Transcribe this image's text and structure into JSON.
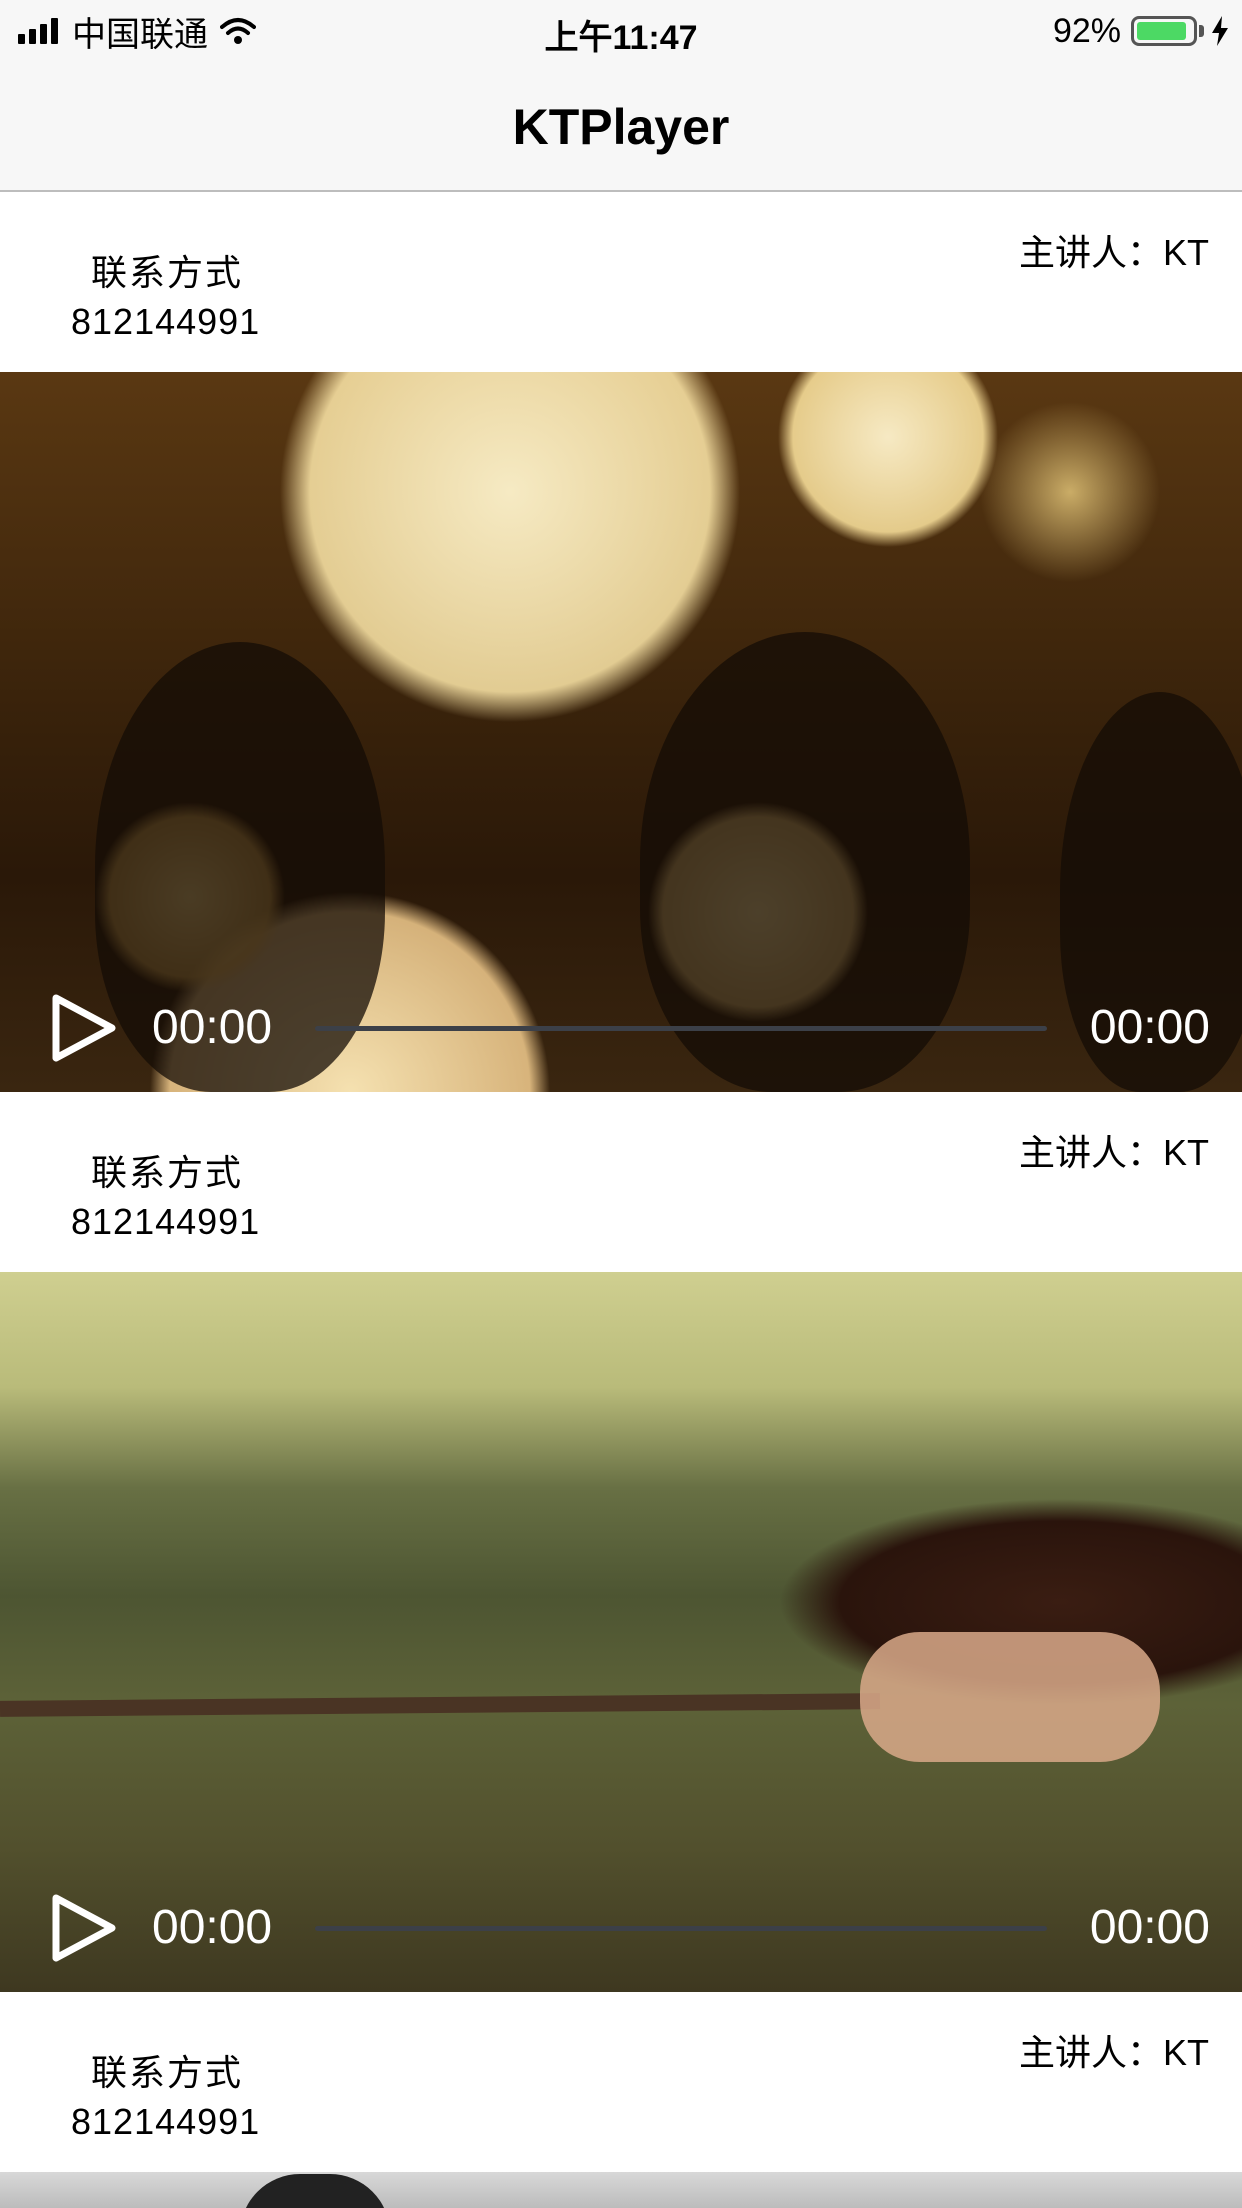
{
  "status_bar": {
    "carrier": "中国联通",
    "time": "上午11:47",
    "battery_percent": "92%",
    "battery_level": 0.92,
    "icons": [
      "signal-icon",
      "wifi-icon",
      "battery-icon",
      "charging-bolt-icon"
    ]
  },
  "nav": {
    "title": "KTPlayer"
  },
  "feed": [
    {
      "contact_label": "联系方式",
      "contact_number": "812144991",
      "speaker": "主讲人：KT",
      "current_time": "00:00",
      "total_time": "00:00",
      "progress": 0
    },
    {
      "contact_label": "联系方式",
      "contact_number": "812144991",
      "speaker": "主讲人：KT",
      "current_time": "00:00",
      "total_time": "00:00",
      "progress": 0
    },
    {
      "contact_label": "联系方式",
      "contact_number": "812144991",
      "speaker": "主讲人：KT"
    }
  ],
  "colors": {
    "bar_background": "#f7f7f7",
    "battery_green": "#4cd964",
    "progress_track": "#3c4048",
    "overlay_text": "#ffffff"
  }
}
